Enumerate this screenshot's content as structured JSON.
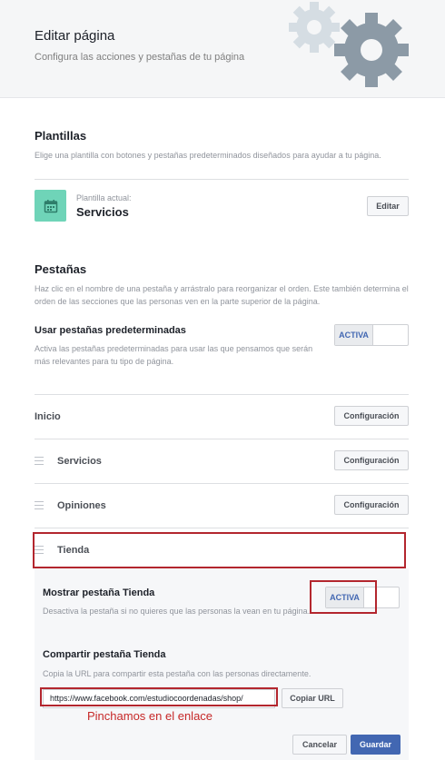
{
  "header": {
    "title": "Editar página",
    "subtitle": "Configura las acciones y pestañas de tu página"
  },
  "templates": {
    "title": "Plantillas",
    "description": "Elige una plantilla con botones y pestañas predeterminados diseñados para ayudar a tu página.",
    "current_label": "Plantilla actual:",
    "current_value": "Servicios",
    "edit_label": "Editar"
  },
  "tabs": {
    "title": "Pestañas",
    "description": "Haz clic en el nombre de una pestaña y arrástralo para reorganizar el orden. Este también determina el orden de las secciones que las personas ven en la parte superior de la página.",
    "default_tabs": {
      "label": "Usar pestañas predeterminadas",
      "description": "Activa las pestañas predeterminadas para usar las que pensamos que serán más relevantes para tu tipo de página.",
      "toggle": "ACTIVA"
    },
    "items": [
      {
        "label": "Inicio",
        "button": "Configuración"
      },
      {
        "label": "Servicios",
        "button": "Configuración"
      },
      {
        "label": "Opiniones",
        "button": "Configuración"
      },
      {
        "label": "Tienda"
      }
    ]
  },
  "shop": {
    "show_label": "Mostrar pestaña Tienda",
    "show_description": "Desactiva la pestaña si no quieres que las personas la vean en tu página.",
    "toggle": "ACTIVA",
    "share_label": "Compartir pestaña Tienda",
    "share_description": "Copia la URL para compartir esta pestaña con las personas directamente.",
    "url": "https://www.facebook.com/estudiocoordenadas/shop/",
    "copy_label": "Copiar URL",
    "cancel_label": "Cancelar",
    "save_label": "Guardar"
  },
  "annotation": "Pinchamos en el enlace",
  "colors": {
    "accent": "#4267b2",
    "template_icon": "#6fd4b8",
    "annotation_red": "#b3262e",
    "gear_light": "#d5dde3",
    "gear_dark": "#8c9aa6"
  },
  "icons": {
    "template": "calendar-icon",
    "header_decoration": "gear-icon",
    "drag": "drag-handle-icon"
  }
}
